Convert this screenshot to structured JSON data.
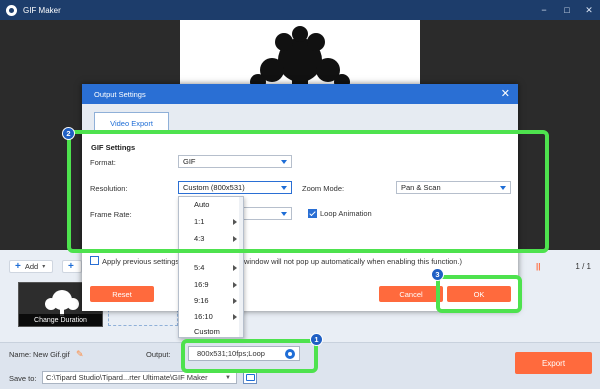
{
  "app": {
    "title": "GIF Maker",
    "window_controls": [
      "−",
      "□",
      "✕"
    ]
  },
  "toolbar": {
    "add_label": "Add",
    "add2_label": "+",
    "page_indicator": "1 / 1",
    "pause_glyph": "||"
  },
  "timeline": {
    "thumbnail_label": "Change Duration"
  },
  "bottom": {
    "name_label": "Name:",
    "name_value": "New Gif.gif",
    "output_label": "Output:",
    "output_value": "800x531;10fps;Loop",
    "save_label": "Save to:",
    "save_path": "C:\\Tipard Studio\\Tipard...rter Ultimate\\GIF Maker",
    "export_label": "Export"
  },
  "dialog": {
    "title": "Output Settings",
    "close_glyph": "✕",
    "tab_label": "Video Export",
    "gif_heading": "GIF Settings",
    "format_label": "Format:",
    "format_value": "GIF",
    "resolution_label": "Resolution:",
    "resolution_value": "Custom (800x531)",
    "framerate_label": "Frame Rate:",
    "zoom_label": "Zoom Mode:",
    "zoom_value": "Pan & Scan",
    "loop_label": "Loop Animation",
    "loop_checked": true,
    "apply_text_left": "Apply previous settings",
    "apply_text_right": "window will not pop up automatically when enabling this function.)",
    "reset_label": "Reset",
    "cancel_label": "Cancel",
    "ok_label": "OK"
  },
  "resolution_dropdown": {
    "items": [
      {
        "label": "Auto",
        "has_submenu": false
      },
      {
        "label": "1:1",
        "has_submenu": true
      },
      {
        "label": "4:3",
        "has_submenu": true
      },
      {
        "label": "5:4",
        "has_submenu": true
      },
      {
        "label": "16:9",
        "has_submenu": true
      },
      {
        "label": "9:16",
        "has_submenu": true
      },
      {
        "label": "16:10",
        "has_submenu": true
      },
      {
        "label": "Custom",
        "has_submenu": false
      }
    ]
  },
  "annotations": {
    "badge_1": "1",
    "badge_2": "2",
    "badge_3": "3",
    "highlight_color": "#4ee24e",
    "badge_color": "#1f5fc4"
  },
  "colors": {
    "accent": "#2a6fd4",
    "primary_button": "#ff6a3d",
    "titlebar": "#1d3d6b"
  }
}
